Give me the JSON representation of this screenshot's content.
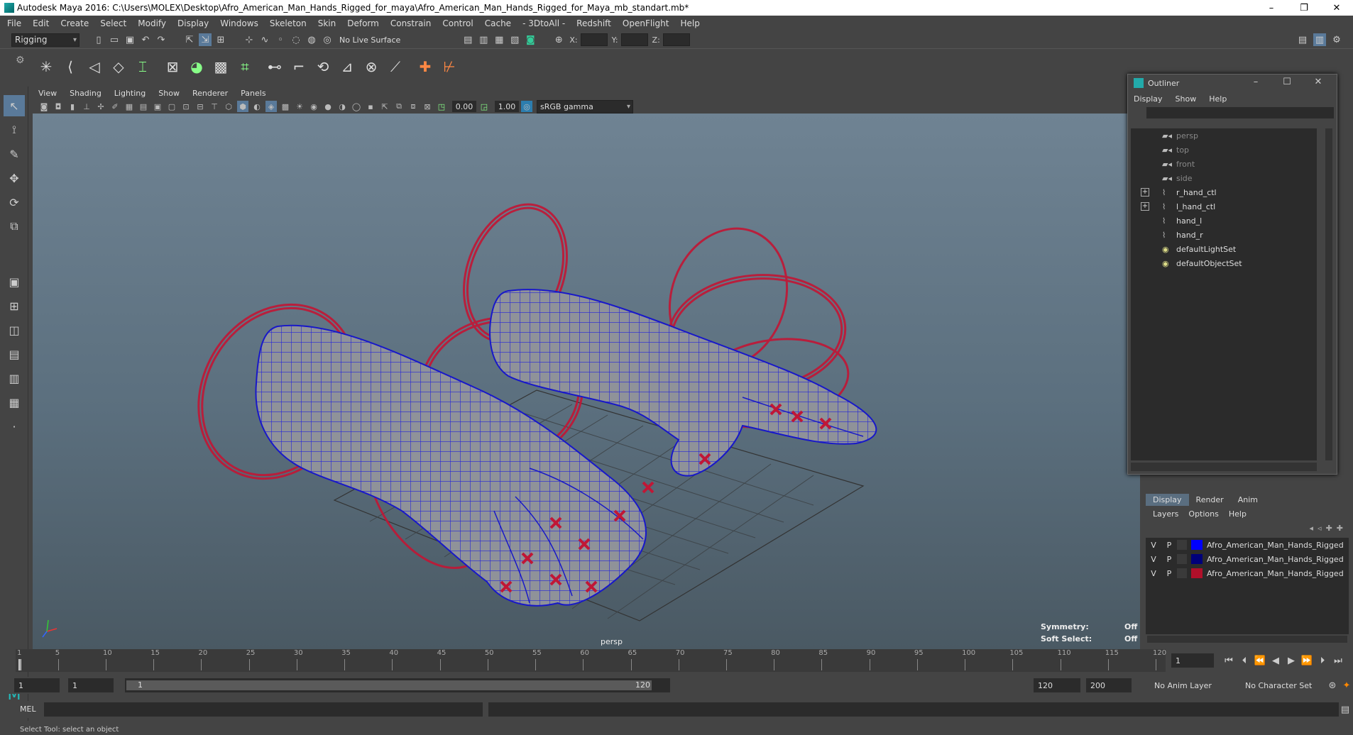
{
  "window": {
    "title": "Autodesk Maya 2016: C:\\Users\\MOLEX\\Desktop\\Afro_American_Man_Hands_Rigged_for_maya\\Afro_American_Man_Hands_Rigged_for_Maya_mb_standart.mb*",
    "minimize": "–",
    "restore": "❐",
    "close": "✕"
  },
  "menubar": [
    "File",
    "Edit",
    "Create",
    "Select",
    "Modify",
    "Display",
    "Windows",
    "Skeleton",
    "Skin",
    "Deform",
    "Constrain",
    "Control",
    "Cache",
    "- 3DtoAll -",
    "Redshift",
    "OpenFlight",
    "Help"
  ],
  "statusline": {
    "menuset": "Rigging",
    "live_surface": "No Live Surface",
    "x_label": "X:",
    "y_label": "Y:",
    "z_label": "Z:"
  },
  "panel": {
    "menu": [
      "View",
      "Shading",
      "Lighting",
      "Show",
      "Renderer",
      "Panels"
    ],
    "exposure": "0.00",
    "gamma": "1.00",
    "color_space": "sRGB gamma"
  },
  "viewport": {
    "camera_name": "persp",
    "symmetry_label": "Symmetry:",
    "symmetry_value": "Off",
    "soft_select_label": "Soft Select:",
    "soft_select_value": "Off"
  },
  "outliner": {
    "title": "Outliner",
    "menu": [
      "Display",
      "Show",
      "Help"
    ],
    "items": [
      {
        "label": "persp",
        "type": "camera",
        "expandable": false
      },
      {
        "label": "top",
        "type": "camera",
        "expandable": false
      },
      {
        "label": "front",
        "type": "camera",
        "expandable": false
      },
      {
        "label": "side",
        "type": "camera",
        "expandable": false
      },
      {
        "label": "r_hand_ctl",
        "type": "transform",
        "expandable": true
      },
      {
        "label": "l_hand_ctl",
        "type": "transform",
        "expandable": true
      },
      {
        "label": "hand_l",
        "type": "transform",
        "expandable": false
      },
      {
        "label": "hand_r",
        "type": "transform",
        "expandable": false
      },
      {
        "label": "defaultLightSet",
        "type": "set",
        "expandable": false
      },
      {
        "label": "defaultObjectSet",
        "type": "set",
        "expandable": false
      }
    ]
  },
  "layer_editor": {
    "tabs": [
      "Display",
      "Render",
      "Anim"
    ],
    "active_tab": "Display",
    "menu": [
      "Layers",
      "Options",
      "Help"
    ],
    "layers": [
      {
        "v": "V",
        "p": "P",
        "color": "#0000ff",
        "name": "Afro_American_Man_Hands_Rigged"
      },
      {
        "v": "V",
        "p": "P",
        "color": "#00007a",
        "name": "Afro_American_Man_Hands_Rigged"
      },
      {
        "v": "V",
        "p": "P",
        "color": "#b0102a",
        "name": "Afro_American_Man_Hands_Rigged"
      }
    ]
  },
  "timeline": {
    "ticks": [
      "1",
      "5",
      "10",
      "15",
      "20",
      "25",
      "30",
      "35",
      "40",
      "45",
      "50",
      "55",
      "60",
      "65",
      "70",
      "75",
      "80",
      "85",
      "90",
      "95",
      "100",
      "105",
      "110",
      "115",
      "120"
    ],
    "current_frame": "1"
  },
  "range": {
    "start": "1",
    "playback_start": "1",
    "slider_start": "1",
    "slider_end": "120",
    "playback_end": "120",
    "end": "200",
    "anim_layer": "No Anim Layer",
    "character_set": "No Character Set"
  },
  "cmdline": {
    "label": "MEL"
  },
  "helpline": {
    "text": "Select Tool: select an object"
  }
}
